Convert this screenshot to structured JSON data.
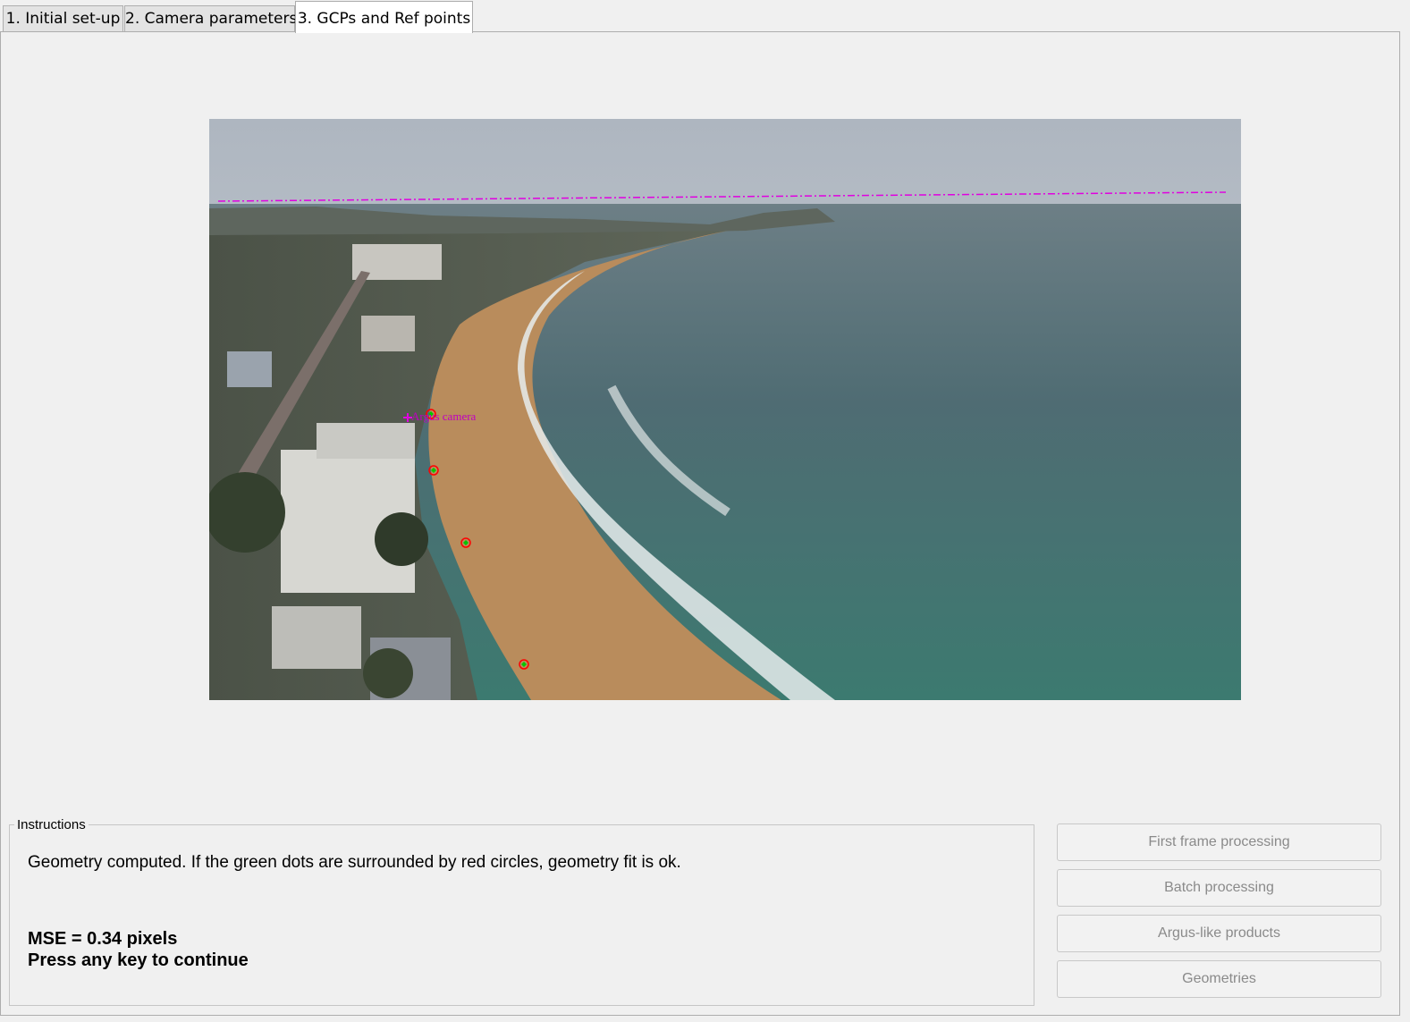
{
  "tabs": [
    {
      "label": "1. Initial set-up",
      "active": false
    },
    {
      "label": "2. Camera parameters",
      "active": false
    },
    {
      "label": "3. GCPs and Ref points",
      "active": true
    }
  ],
  "viewer": {
    "overlay_label": "Argus camera",
    "colors": {
      "horizon_line": "#e000e0",
      "gcp_fill": "#00c800",
      "gcp_ring": "#ff0000"
    }
  },
  "instructions": {
    "title": "Instructions",
    "message": "Geometry computed. If the green dots are surrounded by red circles, geometry fit is ok.",
    "mse": "MSE = 0.34 pixels",
    "prompt": "Press any key to continue"
  },
  "buttons": {
    "first_frame": "First frame processing",
    "batch": "Batch processing",
    "argus": "Argus-like products",
    "geometries": "Geometries"
  }
}
